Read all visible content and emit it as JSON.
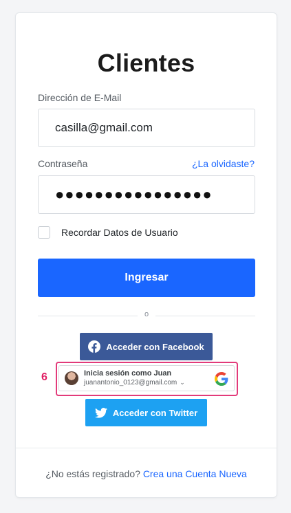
{
  "page": {
    "title": "Clientes"
  },
  "form": {
    "email_label": "Dirección de E-Mail",
    "email_value": "casilla@gmail.com",
    "password_label": "Contraseña",
    "forgot_link": "¿La olvidaste?",
    "password_value": "●●●●●●●●●●●●●●●●",
    "remember_label": "Recordar Datos de Usuario",
    "remember_checked": false,
    "submit_label": "Ingresar",
    "divider_text": "o"
  },
  "social": {
    "facebook_label": "Acceder con Facebook",
    "google_name": "Inicia sesión como Juan",
    "google_email": "juanantonio_0123@gmail.com",
    "twitter_label": "Acceder con Twitter"
  },
  "annotation": {
    "step_number": "6",
    "highlight_color": "#e23a7a"
  },
  "footer": {
    "question": "¿No estás registrado?",
    "register_link": "Crea una Cuenta Nueva"
  },
  "colors": {
    "primary": "#1a66ff",
    "facebook": "#3b5998",
    "twitter": "#1da1f2",
    "annotation": "#e01e63"
  },
  "icons": {
    "facebook": "facebook-icon",
    "google": "google-icon",
    "twitter": "twitter-icon",
    "chevron": "chevron-down-icon"
  }
}
